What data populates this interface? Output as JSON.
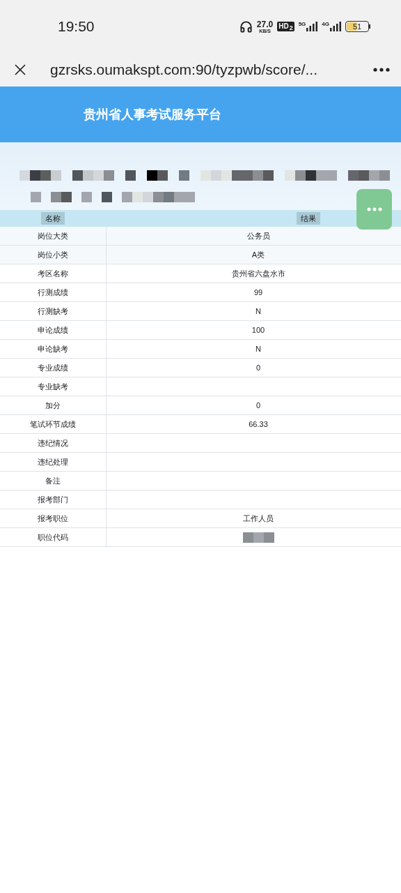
{
  "status_bar": {
    "time": "19:50",
    "speed_value": "27.0",
    "speed_unit": "KB/S",
    "hd_label": "HD",
    "hd_sub": "2",
    "networks": [
      {
        "label": "5G"
      },
      {
        "label": "4G"
      }
    ],
    "battery": {
      "text": "51",
      "level": 0.51
    }
  },
  "address_bar": {
    "url": "gzrsks.oumakspt.com:90/tyzpwb/score/..."
  },
  "header": {
    "title": "贵州省人事考试服务平台"
  },
  "table": {
    "columns": [
      "名称",
      "结果"
    ],
    "rows": [
      {
        "name": "岗位大类",
        "value": "公务员"
      },
      {
        "name": "岗位小类",
        "value": "A类"
      },
      {
        "name": "考区名称",
        "value": "贵州省六盘水市"
      },
      {
        "name": "行测成绩",
        "value": "99"
      },
      {
        "name": "行测缺考",
        "value": "N"
      },
      {
        "name": "申论成绩",
        "value": "100"
      },
      {
        "name": "申论缺考",
        "value": "N"
      },
      {
        "name": "专业成绩",
        "value": "0"
      },
      {
        "name": "专业缺考"
      },
      {
        "name": "加分",
        "value": "0"
      },
      {
        "name": "笔试环节成绩",
        "value": "66.33"
      },
      {
        "name": "违纪情况"
      },
      {
        "name": "违纪处理"
      },
      {
        "name": "备注"
      },
      {
        "name": "报考部门"
      },
      {
        "name": "报考职位",
        "value": "工作人员"
      },
      {
        "name": "职位代码",
        "redacted": true
      }
    ]
  }
}
